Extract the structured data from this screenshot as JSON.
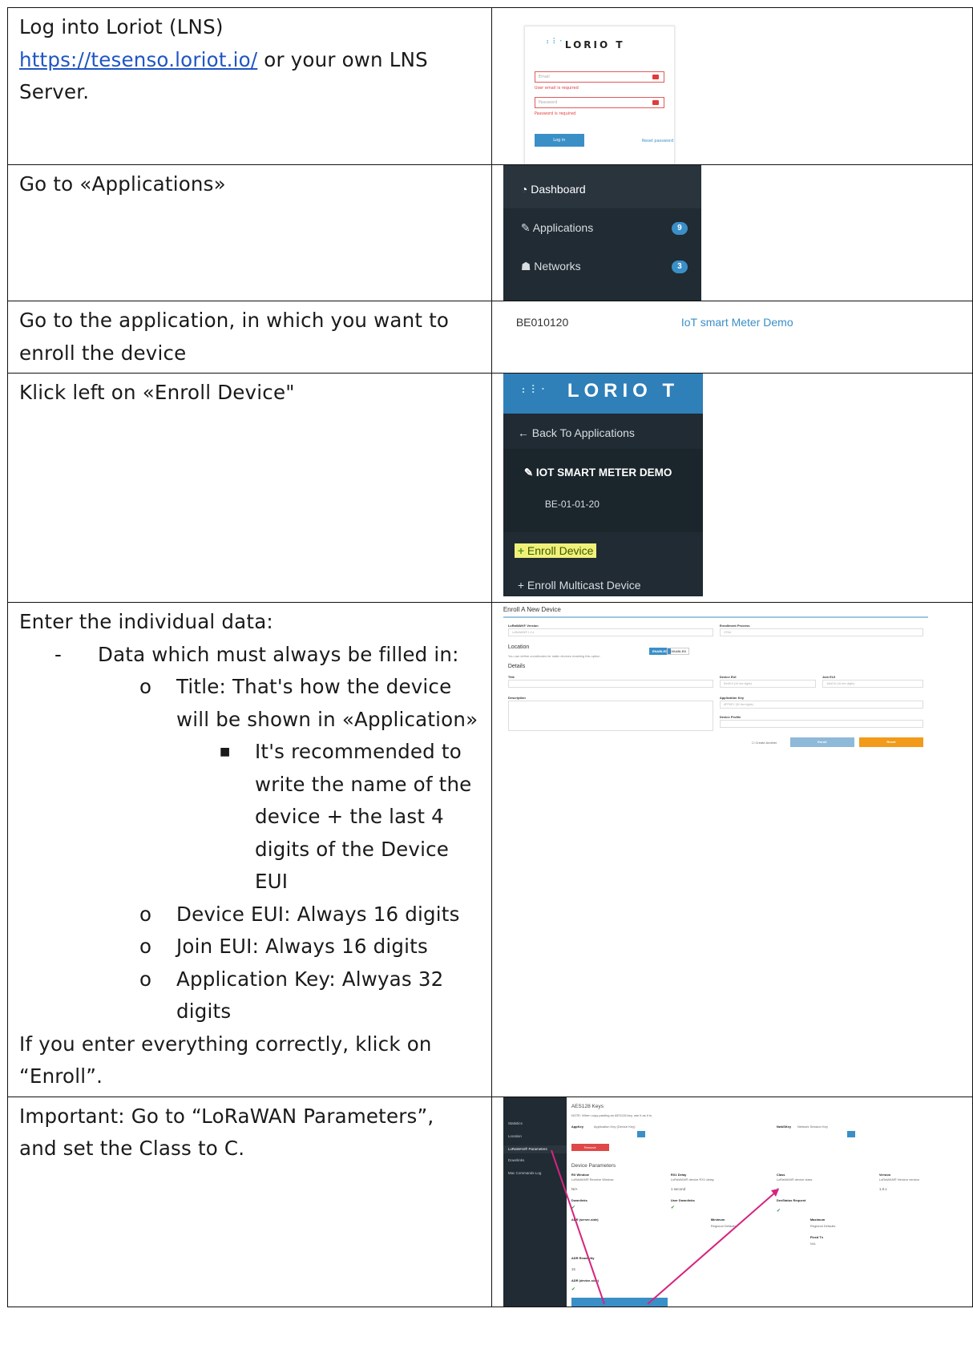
{
  "rows": [
    {
      "left": {
        "line1": "Log into Loriot (LNS)",
        "link": "https://tesenso.loriot.io/",
        "after_link": " or your own LNS",
        "line3": "Server."
      },
      "login": {
        "brand": "LORIO T",
        "email_placeholder": "Email",
        "email_error": "User email is required",
        "password_placeholder": "Password",
        "password_error": "Password is required",
        "login_button": "Log in",
        "reset_link": "Reset password"
      }
    },
    {
      "left": {
        "line1": "Go to «Applications»"
      },
      "nav": {
        "items": [
          {
            "label": "Dashboard"
          },
          {
            "label": "Applications",
            "badge": "9"
          },
          {
            "label": "Networks",
            "badge": "3"
          }
        ]
      }
    },
    {
      "left": {
        "line1": "Go to the application, in which you want to",
        "line2": "enroll the device"
      },
      "app": {
        "id": "BE010120",
        "name": "IoT smart Meter Demo"
      }
    },
    {
      "left": {
        "line1": "Klick left on «Enroll Device\""
      },
      "sidebar": {
        "brand": "LORIO T",
        "back": "Back To Applications",
        "app_name": "IOT SMART METER DEMO",
        "app_code": "BE-01-01-20",
        "enroll": "Enroll Device",
        "enroll_multicast": "Enroll Multicast Device"
      }
    },
    {
      "left": {
        "intro": "Enter the individual data:",
        "bullet_dash": "-",
        "must": "Data which must always be filled in:",
        "title_item": "Title: That's how the device will be shown in «Application»",
        "title_sub": "It's recommended to write the name of the device + the last 4 digits of the Device EUI",
        "deveui_item": "Device EUI: Always 16 digits",
        "joineui_item": "Join EUI: Always 16 digits",
        "appkey_item": "Application Key: Alwyas 32 digits",
        "outro": "If you enter everything correctly, klick on “Enroll”."
      },
      "enroll_form": {
        "title": "Enroll A New Device",
        "lorawan_version_label": "LoRaWAN® Version",
        "lorawan_version_value": "LoRaWAN® 1.0.x",
        "enrollment_label": "Enrollment Process",
        "enrollment_value": "OTAA",
        "location": "Location",
        "location_note": "You can define coordinates for static devices enabling this option",
        "enabled": "ENABLED",
        "disabled": "DISABLED",
        "details": "Details",
        "title_label": "Title",
        "deveui_label": "Device EUI",
        "deveui_placeholder": "DevEUI (16 hex digits)",
        "joineui_label": "Join EUI",
        "joineui_placeholder": "JoinEUI (16 hex digits)",
        "description_label": "Description",
        "appkey_label": "Application Key",
        "appkey_placeholder": "APPKEY (32 hex digits)",
        "profile_label": "Device Profile",
        "create_another": "Create Another",
        "enroll_button": "Enroll",
        "reset_button": "Reset"
      }
    },
    {
      "left": {
        "line1": "Important: Go to “LoRaWAN Parameters”,",
        "line2": "and set the Class to C."
      },
      "device": {
        "side_items": [
          "Statistics",
          "Location",
          "LoRaWAN® Parameters",
          "Downlinks",
          "Mac Commands Log"
        ],
        "aes_title": "AES128 Keys",
        "note": "NOTE: When copy-pasting an AES128 key, use it as it is.",
        "appkey_label": "AppKey",
        "appkey_sub": "Application Key (Device Key)",
        "remove": "Remove",
        "nwkskey_label": "NwkSKey",
        "nwkskey_sub": "Network Session Key",
        "params_title": "Device Parameters",
        "rx_window": "RX Window",
        "rx_window_sub": "LoRaWAN® Receive Window",
        "rx_window_val": "N/A",
        "rx1_delay": "RX1 Delay",
        "rx1_delay_sub": "LoRaWAN® device RX1 delay",
        "rx1_delay_val": "1 second",
        "class": "Class",
        "class_sub": "LoRaWAN® device class",
        "class_val": "C",
        "version": "Version",
        "version_sub": "LoRaWAN® Version version",
        "version_val": "1.0.x",
        "downlinks": "Downlinks",
        "user_downlinks": "User Downlinks",
        "devstatus": "DevStatus Request",
        "adr_server": "ADR (server-side)",
        "minimum": "Minimum",
        "minimum_val": "Regional Defaults",
        "maximum": "Maximum",
        "maximum_val": "Regional Defaults",
        "fixed_tx": "Fixed Tx",
        "fixed_tx_val": "N/A",
        "adr_reactivity": "ADR Reactivity",
        "adr_reactivity_val": "15",
        "adr_device": "ADR (device-side)",
        "arrow_color": "#d6247e"
      }
    }
  ]
}
